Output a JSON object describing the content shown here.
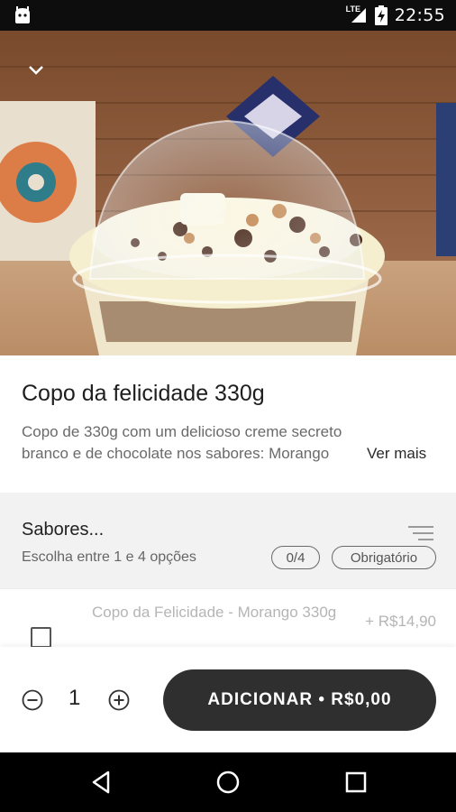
{
  "status_bar": {
    "time": "22:55",
    "network": "LTE",
    "app_icon": "android-icon",
    "icons": [
      "signal-icon",
      "battery-charging-icon"
    ]
  },
  "hero": {
    "collapse_icon": "chevron-down-icon"
  },
  "product": {
    "title": "Copo da felicidade 330g",
    "description_line1": "Copo de 330g com um delicioso creme secreto",
    "description_line2": "branco e de chocolate nos sabores: Morango",
    "see_more": "Ver mais"
  },
  "section": {
    "title": "Sabores...",
    "subtitle": "Escolha entre 1 e 4 opções",
    "count_badge": "0/4",
    "required_badge": "Obrigatório"
  },
  "options": [
    {
      "name": "Copo da Felicidade - Morango 330g",
      "price": "+ R$14,90",
      "checked": false
    }
  ],
  "cart": {
    "quantity": "1",
    "add_button": "ADICIONAR • R$0,00"
  },
  "nav": {
    "icons": [
      "back-icon",
      "home-icon",
      "recents-icon"
    ]
  },
  "colors": {
    "button_bg": "#2f2f2f",
    "section_bg": "#f2f2f2",
    "muted_text": "#b5b5b5"
  }
}
